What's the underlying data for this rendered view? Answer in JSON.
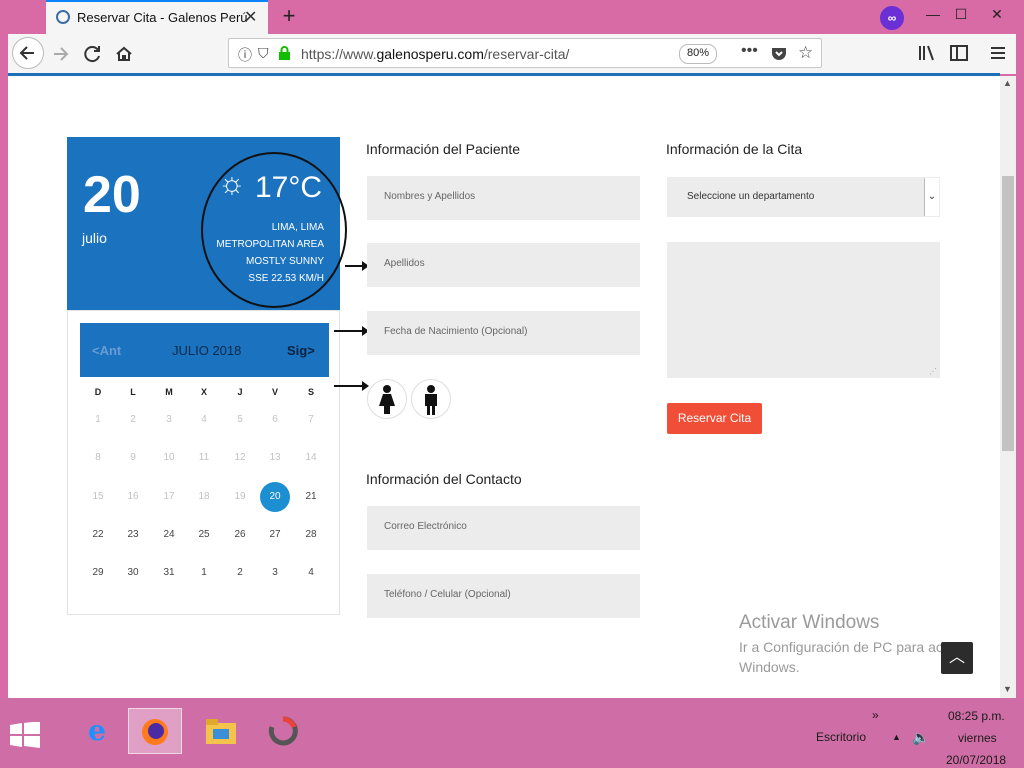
{
  "browser": {
    "tab_title": "Reservar Cita - Galenos Perú",
    "url_prefix": "https://www.",
    "url_domain": "galenosperu.com",
    "url_path": "/reservar-cita/",
    "zoom": "80%",
    "new_tab_label": "+",
    "close_tab_label": "✕",
    "window_minimize": "—",
    "window_maximize": "☐",
    "window_close": "✕"
  },
  "weather": {
    "day": "20",
    "month": "julio",
    "temperature": "17°C",
    "location_line1": "LIMA, LIMA",
    "location_line2": "METROPOLITAN AREA",
    "condition": "MOSTLY SUNNY",
    "wind": "SSE 22.53 KM/H"
  },
  "calendar": {
    "prev_label": "<Ant",
    "next_label": "Sig>",
    "month_label": "JULIO 2018",
    "weekdays": [
      "D",
      "L",
      "M",
      "X",
      "J",
      "V",
      "S"
    ],
    "weeks": [
      [
        "1",
        "2",
        "3",
        "4",
        "5",
        "6",
        "7"
      ],
      [
        "8",
        "9",
        "10",
        "11",
        "12",
        "13",
        "14"
      ],
      [
        "15",
        "16",
        "17",
        "18",
        "19",
        "20",
        "21"
      ],
      [
        "22",
        "23",
        "24",
        "25",
        "26",
        "27",
        "28"
      ],
      [
        "29",
        "30",
        "31",
        "1",
        "2",
        "3",
        "4"
      ]
    ],
    "selected_day": "20"
  },
  "patient": {
    "heading": "Información del Paciente",
    "name_placeholder": "Nombres y Apellidos",
    "surname_placeholder": "Apellidos",
    "birth_placeholder": "Fecha de Nacimiento (Opcional)"
  },
  "contact": {
    "heading": "Información del Contacto",
    "email_placeholder": "Correo Electrónico",
    "phone_placeholder": "Teléfono / Celular (Opcional)"
  },
  "appointment": {
    "heading": "Información de la Cita",
    "department_select": "Seleccione un departamento",
    "submit_label": "Reservar Cita"
  },
  "watermark": {
    "title": "Activar Windows",
    "subtitle": "Ir a Configuración de PC para activar Windows."
  },
  "taskbar": {
    "desktop_label": "Escritorio",
    "time": "08:25 p.m.",
    "weekday": "viernes",
    "date": "20/07/2018"
  },
  "icons": [
    "firefox-favicon",
    "back-icon",
    "forward-icon",
    "reload-icon",
    "home-icon",
    "info-icon",
    "shield-icon",
    "lock-icon",
    "more-icon",
    "pocket-icon",
    "bookmark-star-icon",
    "library-icon",
    "sidebar-icon",
    "menu-icon",
    "sun-icon",
    "female-icon",
    "male-icon",
    "windows-start-icon",
    "ie-icon",
    "firefox-icon",
    "file-explorer-icon",
    "app-icon",
    "volume-icon"
  ]
}
